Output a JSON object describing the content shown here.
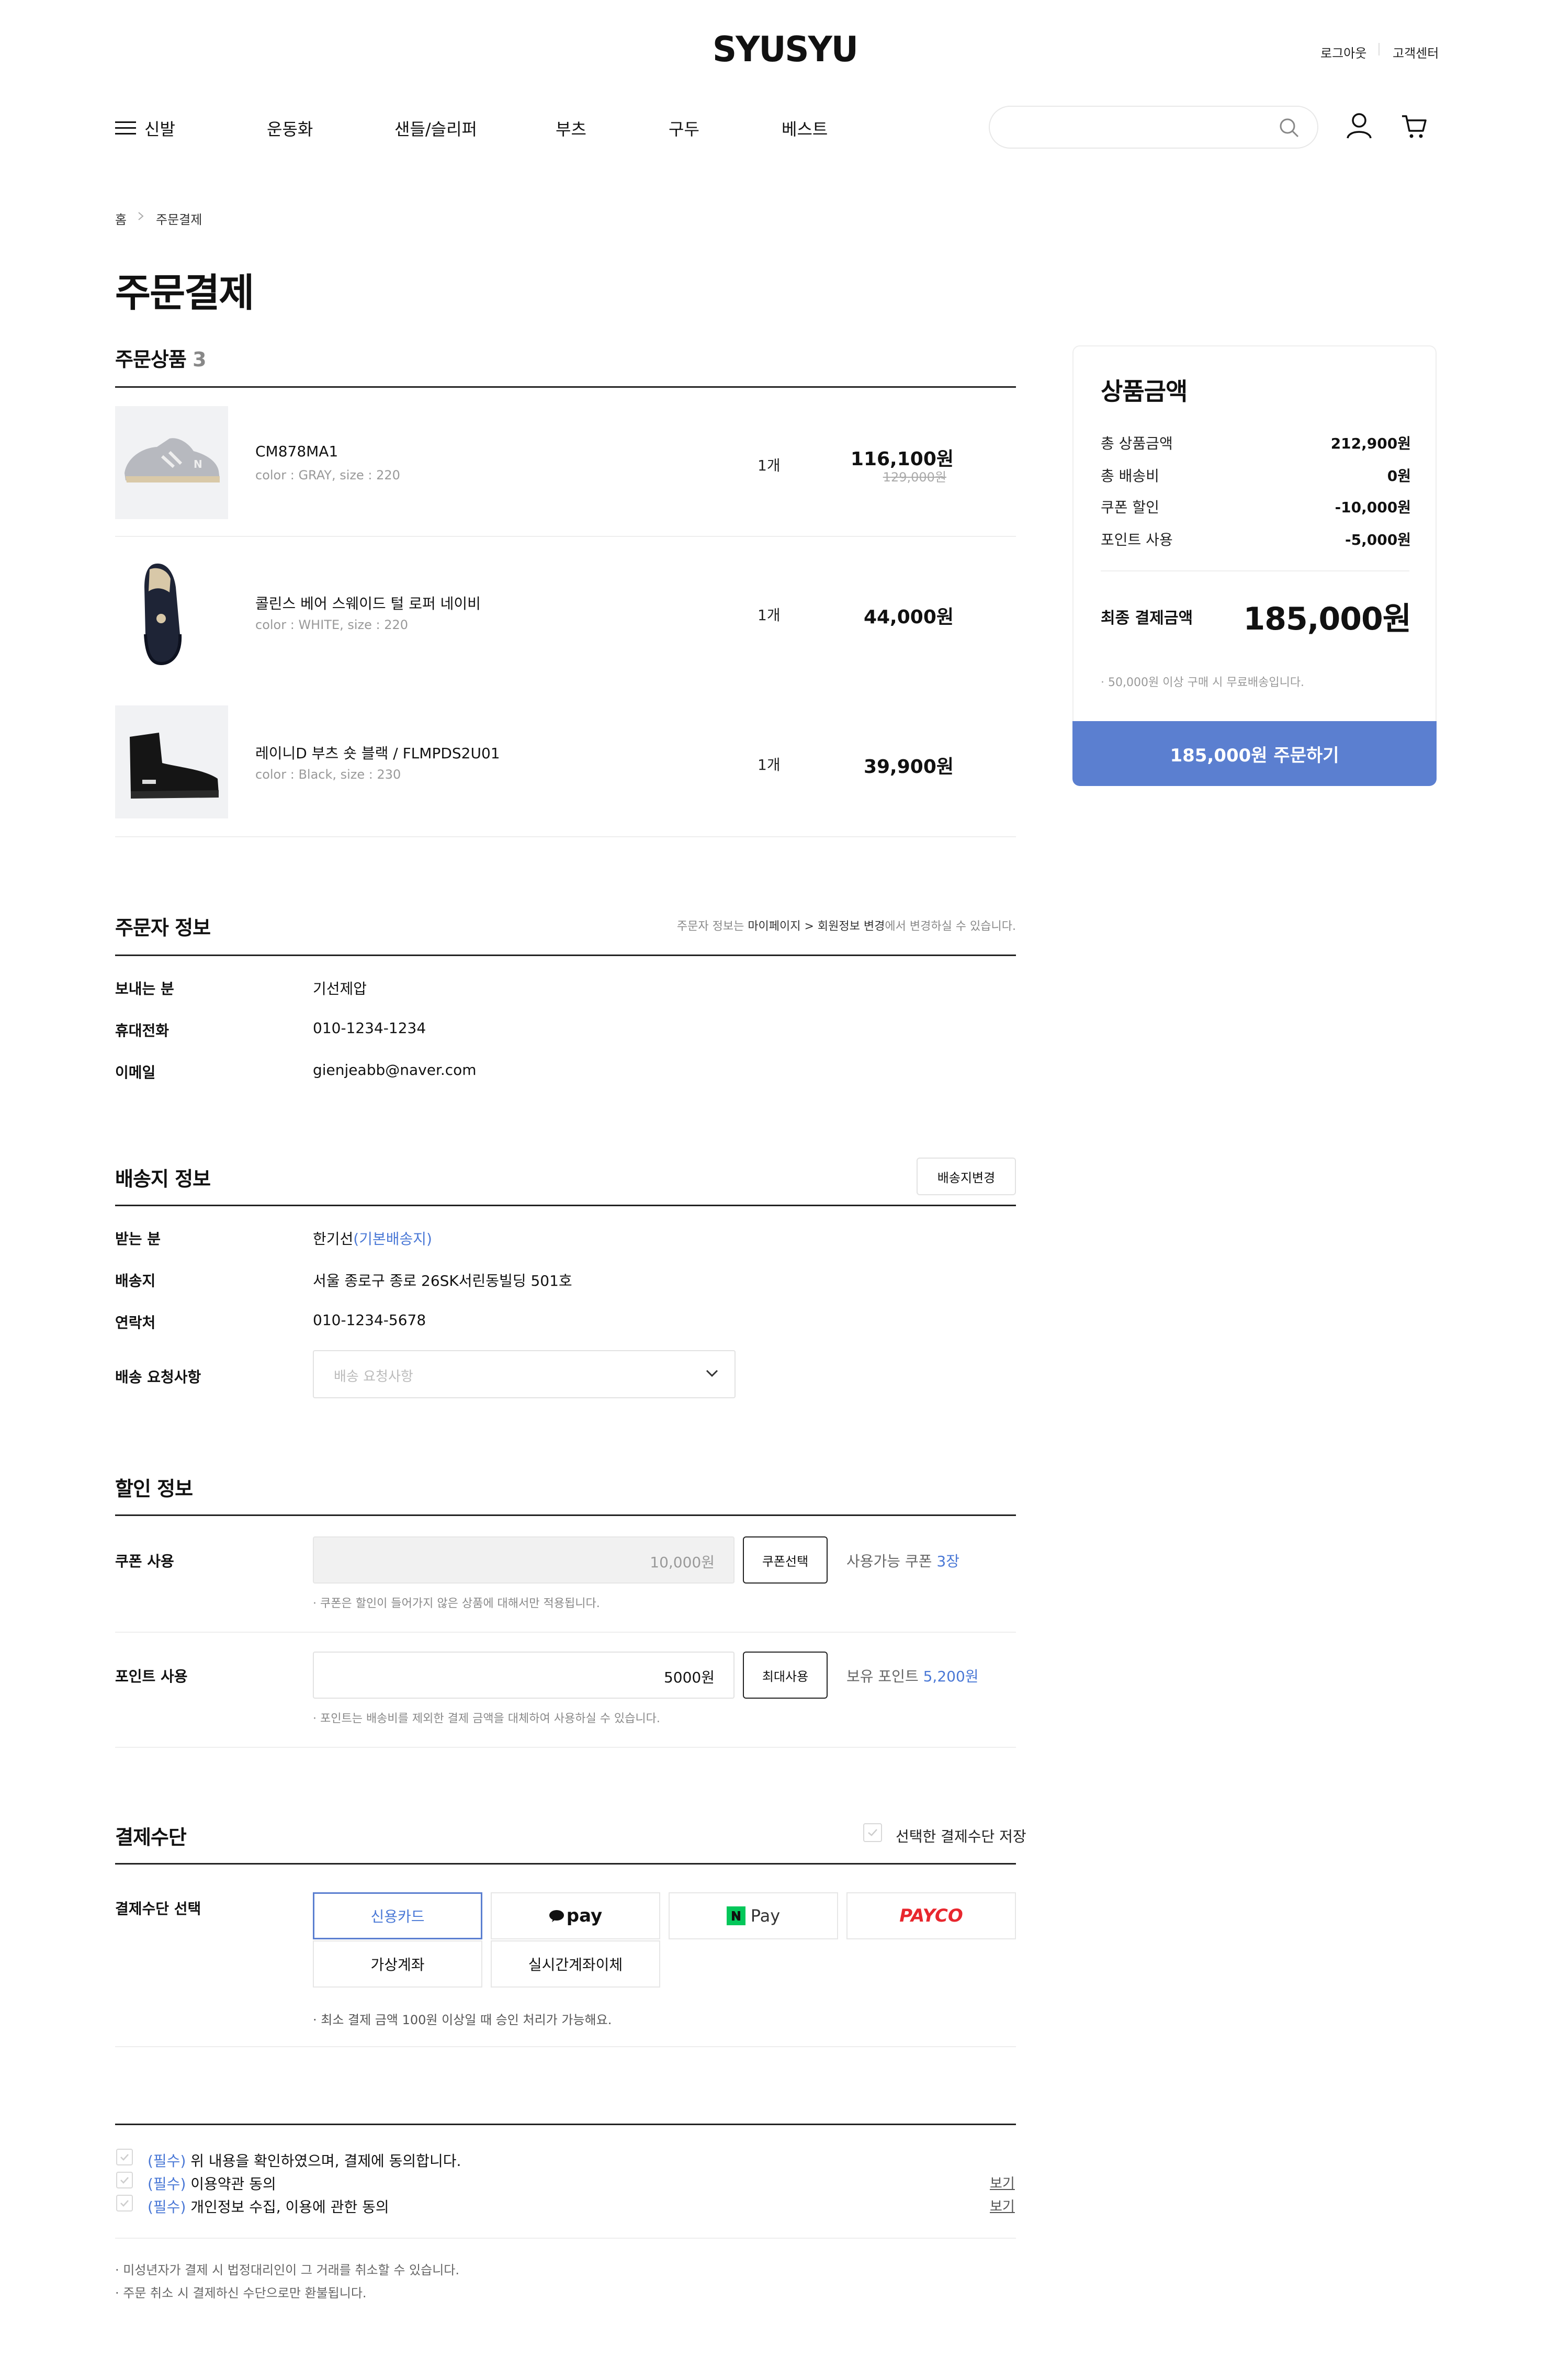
{
  "header": {
    "logo": "SYUSYU",
    "logout": "로그아웃",
    "support": "고객센터",
    "nav": [
      "신발",
      "운동화",
      "샌들/슬리퍼",
      "부츠",
      "구두",
      "베스트"
    ]
  },
  "breadcrumb": [
    "홈",
    "주문결제"
  ],
  "page_title": "주문결제",
  "products": {
    "title": "주문상품",
    "count": "3",
    "items": [
      {
        "name": "CM878MA1",
        "option": "color : GRAY, size : 220",
        "qty": "1개",
        "price": "116,100원",
        "original_price": "129,000원"
      },
      {
        "name": "콜린스 베어 스웨이드 털 로퍼 네이비",
        "option": "color : WHITE, size : 220",
        "qty": "1개",
        "price": "44,000원",
        "original_price": ""
      },
      {
        "name": "레이니D 부츠 숏 블랙 / FLMPDS2U01",
        "option": "color : Black, size : 230",
        "qty": "1개",
        "price": "39,900원",
        "original_price": ""
      }
    ]
  },
  "orderer": {
    "title": "주문자 정보",
    "note_prefix": "주문자 정보는 ",
    "note_link": "마이페이지 > 회원정보 변경",
    "note_suffix": "에서 변경하실 수 있습니다.",
    "rows": [
      {
        "label": "보내는 분",
        "value": "기선제압"
      },
      {
        "label": "휴대전화",
        "value": "010-1234-1234"
      },
      {
        "label": "이메일",
        "value": "gienjeabb@naver.com"
      }
    ]
  },
  "shipping": {
    "title": "배송지 정보",
    "change_button": "배송지변경",
    "receiver_label": "받는 분",
    "receiver": "한기선",
    "receiver_tag": "(기본배송지)",
    "address_label": "배송지",
    "address": "서울 종로구 종로 26SK서린동빌딩 501호",
    "contact_label": "연락처",
    "contact": "010-1234-5678",
    "request_label": "배송 요청사항",
    "request_placeholder": "배송 요청사항"
  },
  "discount": {
    "title": "할인 정보",
    "coupon_label": "쿠폰 사용",
    "coupon_value": "10,000원",
    "coupon_button": "쿠폰선택",
    "coupon_avail_prefix": "사용가능 쿠폰 ",
    "coupon_avail_count": "3장",
    "coupon_note": "· 쿠폰은 할인이 들어가지 않은 상품에 대해서만 적용됩니다.",
    "point_label": "포인트 사용",
    "point_value": "5000원",
    "point_button": "최대사용",
    "point_avail_prefix": "보유 포인트 ",
    "point_avail_amount": "5,200원",
    "point_note": "· 포인트는 배송비를 제외한 결제 금액을 대체하여 사용하실 수 있습니다."
  },
  "payment": {
    "title": "결제수단",
    "save_label": "선택한 결제수단 저장",
    "select_label": "결제수단 선택",
    "methods": [
      "신용카드",
      "pay",
      "Pay",
      "PAYCO",
      "가상계좌",
      "실시간계좌이체"
    ],
    "note": "· 최소 결제 금액 100원 이상일 때 승인 처리가 가능해요."
  },
  "agreements": [
    {
      "required": "(필수)",
      "text": " 위 내용을 확인하였으며, 결제에 동의합니다.",
      "link": ""
    },
    {
      "required": "(필수)",
      "text": " 이용약관 동의",
      "link": "보기"
    },
    {
      "required": "(필수)",
      "text": " 개인정보 수집, 이용에 관한 동의",
      "link": "보기"
    }
  ],
  "footnotes": [
    "· 미성년자가 결제 시 법정대리인이 그 거래를 취소할 수 있습니다.",
    "· 주문 취소 시 결제하신 수단으로만 환불됩니다."
  ],
  "summary": {
    "title": "상품금액",
    "rows": [
      {
        "label": "총 상품금액",
        "value": "212,900원"
      },
      {
        "label": "총 배송비",
        "value": "0원"
      },
      {
        "label": "쿠폰 할인",
        "value": "-10,000원"
      },
      {
        "label": "포인트 사용",
        "value": "-5,000원"
      }
    ],
    "final_label": "최종 결제금액",
    "final_value": "185,000원",
    "free_ship_note": "· 50,000원 이상 구매 시 무료배송입니다.",
    "order_button": "185,000원 주문하기"
  },
  "colors": {
    "accent": "#5b7fd0",
    "link": "#4a78d6",
    "payco": "#e8272e",
    "naver": "#03c75a"
  }
}
